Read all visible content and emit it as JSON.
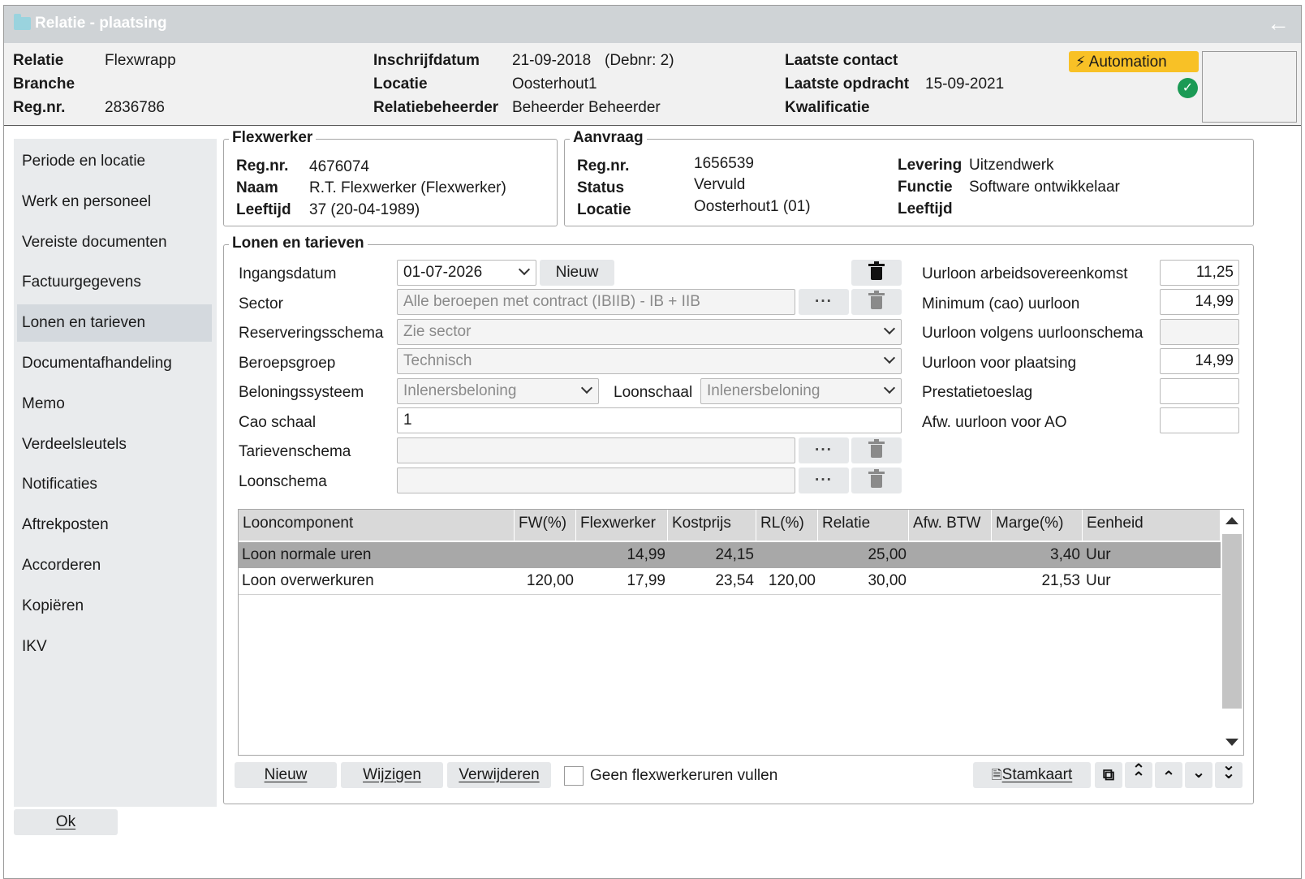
{
  "window": {
    "title": "Relatie - plaatsing",
    "back_icon": "arrow-left-icon"
  },
  "info": {
    "relatie_label": "Relatie",
    "relatie_value": "Flexwrapp",
    "branche_label": "Branche",
    "branche_value": "",
    "regnr_label": "Reg.nr.",
    "regnr_value": "2836786",
    "inschrijfdatum_label": "Inschrijfdatum",
    "inschrijfdatum_value": "21-09-2018",
    "debnr_value": "(Debnr: 2)",
    "locatie_label": "Locatie",
    "locatie_value": "Oosterhout1",
    "relatiebeheerder_label": "Relatiebeheerder",
    "relatiebeheerder_value": "Beheerder Beheerder",
    "laatste_contact_label": "Laatste contact",
    "laatste_contact_value": "",
    "laatste_opdracht_label": "Laatste opdracht",
    "laatste_opdracht_value": "15-09-2021",
    "kwalificatie_label": "Kwalificatie",
    "kwalificatie_value": "",
    "automation_label": "Automation",
    "automation_color": "#f8c126",
    "status_color": "#1b9a55"
  },
  "sidebar": {
    "items": [
      {
        "label": "Periode en locatie"
      },
      {
        "label": "Werk en personeel"
      },
      {
        "label": "Vereiste documenten"
      },
      {
        "label": "Factuurgegevens"
      },
      {
        "label": "Lonen en tarieven",
        "active": true
      },
      {
        "label": "Documentafhandeling"
      },
      {
        "label": "Memo"
      },
      {
        "label": "Verdeelsleutels"
      },
      {
        "label": "Notificaties"
      },
      {
        "label": "Aftrekposten"
      },
      {
        "label": "Accorderen"
      },
      {
        "label": "Kopiëren"
      },
      {
        "label": "IKV"
      }
    ]
  },
  "flexwerker": {
    "title": "Flexwerker",
    "regnr_label": "Reg.nr.",
    "regnr_value": "4676074",
    "naam_label": "Naam",
    "naam_value": "R.T. Flexwerker (Flexwerker)",
    "leeftijd_label": "Leeftijd",
    "leeftijd_value": "37 (20-04-1989)"
  },
  "aanvraag": {
    "title": "Aanvraag",
    "regnr_label": "Reg.nr.",
    "regnr_value": "1656539",
    "status_label": "Status",
    "status_value": "Vervuld",
    "locatie_label": "Locatie",
    "locatie_value": "Oosterhout1 (01)",
    "levering_label": "Levering",
    "levering_value": "Uitzendwerk",
    "functie_label": "Functie",
    "functie_value": "Software ontwikkelaar",
    "leeftijd_label": "Leeftijd",
    "leeftijd_value": ""
  },
  "lonen": {
    "title": "Lonen en tarieven",
    "ingangsdatum_label": "Ingangsdatum",
    "ingangsdatum_value": "01-07-2026",
    "nieuw_label": "Nieuw",
    "sector_label": "Sector",
    "sector_value": "Alle beroepen met contract (IBIIB) - IB + IIB",
    "reservering_label": "Reserveringsschema",
    "reservering_value": "Zie sector",
    "beroepsgroep_label": "Beroepsgroep",
    "beroepsgroep_value": "Technisch",
    "beloning_label": "Beloningssysteem",
    "beloning_value": "Inlenersbeloning",
    "loonschaal_label": "Loonschaal",
    "loonschaal_value": "Inlenersbeloning",
    "cao_schaal_label": "Cao schaal",
    "cao_schaal_value": "1",
    "tarievenschema_label": "Tarievenschema",
    "tarievenschema_value": "",
    "loonschema_label": "Loonschema",
    "loonschema_value": "",
    "dots": "···",
    "right": {
      "uurloon_ao_label": "Uurloon arbeidsovereenkomst",
      "uurloon_ao_value": "11,25",
      "min_cao_label": "Minimum (cao) uurloon",
      "min_cao_value": "14,99",
      "uurloon_schema_label": "Uurloon volgens uurloonschema",
      "uurloon_schema_value": "",
      "uurloon_plaatsing_label": "Uurloon voor plaatsing",
      "uurloon_plaatsing_value": "14,99",
      "prestatietoeslag_label": "Prestatietoeslag",
      "prestatietoeslag_value": "",
      "afw_uurloon_label": "Afw. uurloon voor AO",
      "afw_uurloon_value": ""
    }
  },
  "table": {
    "columns": [
      "Looncomponent",
      "FW(%)",
      "Flexwerker",
      "Kostprijs",
      "RL(%)",
      "Relatie",
      "Afw. BTW",
      "Marge(%)",
      "Eenheid"
    ],
    "rows": [
      {
        "looncomponent": "Loon normale uren",
        "fw": "",
        "flexwerker": "14,99",
        "kostprijs": "24,15",
        "rl": "",
        "relatie": "25,00",
        "afw_btw": "",
        "marge": "3,40",
        "eenheid": "Uur"
      },
      {
        "looncomponent": "Loon overwerkuren",
        "fw": "120,00",
        "flexwerker": "17,99",
        "kostprijs": "23,54",
        "rl": "120,00",
        "relatie": "30,00",
        "afw_btw": "",
        "marge": "21,53",
        "eenheid": "Uur"
      }
    ]
  },
  "footer": {
    "nieuw_label": "Nieuw",
    "wijzigen_label": "Wijzigen",
    "verwijderen_label": "Verwijderen",
    "checkbox_label": "Geen flexwerkeruren vullen",
    "stamkaart_label": "Stamkaart",
    "ok_label": "Ok"
  }
}
